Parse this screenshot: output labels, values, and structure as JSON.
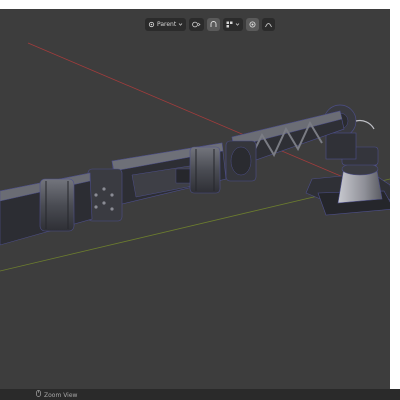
{
  "header": {
    "pivot_label": "Parent",
    "icons": [
      "cursor-arrow-icon",
      "chevron-down-icon",
      "transform-orientation-icon",
      "snap-icon",
      "snap-increment-icon",
      "proportional-edit-icon"
    ]
  },
  "status": {
    "hint_label": "Zoom View",
    "hint_icon": "mouse-icon"
  },
  "colors": {
    "viewport_bg": "#3d3d3d",
    "x_axis": "#a03c3c",
    "y_axis": "#6c7d2e",
    "mesh_dark": "#2c2d33",
    "mesh_light": "#6a6c74",
    "edge": "#4d4f8a"
  }
}
